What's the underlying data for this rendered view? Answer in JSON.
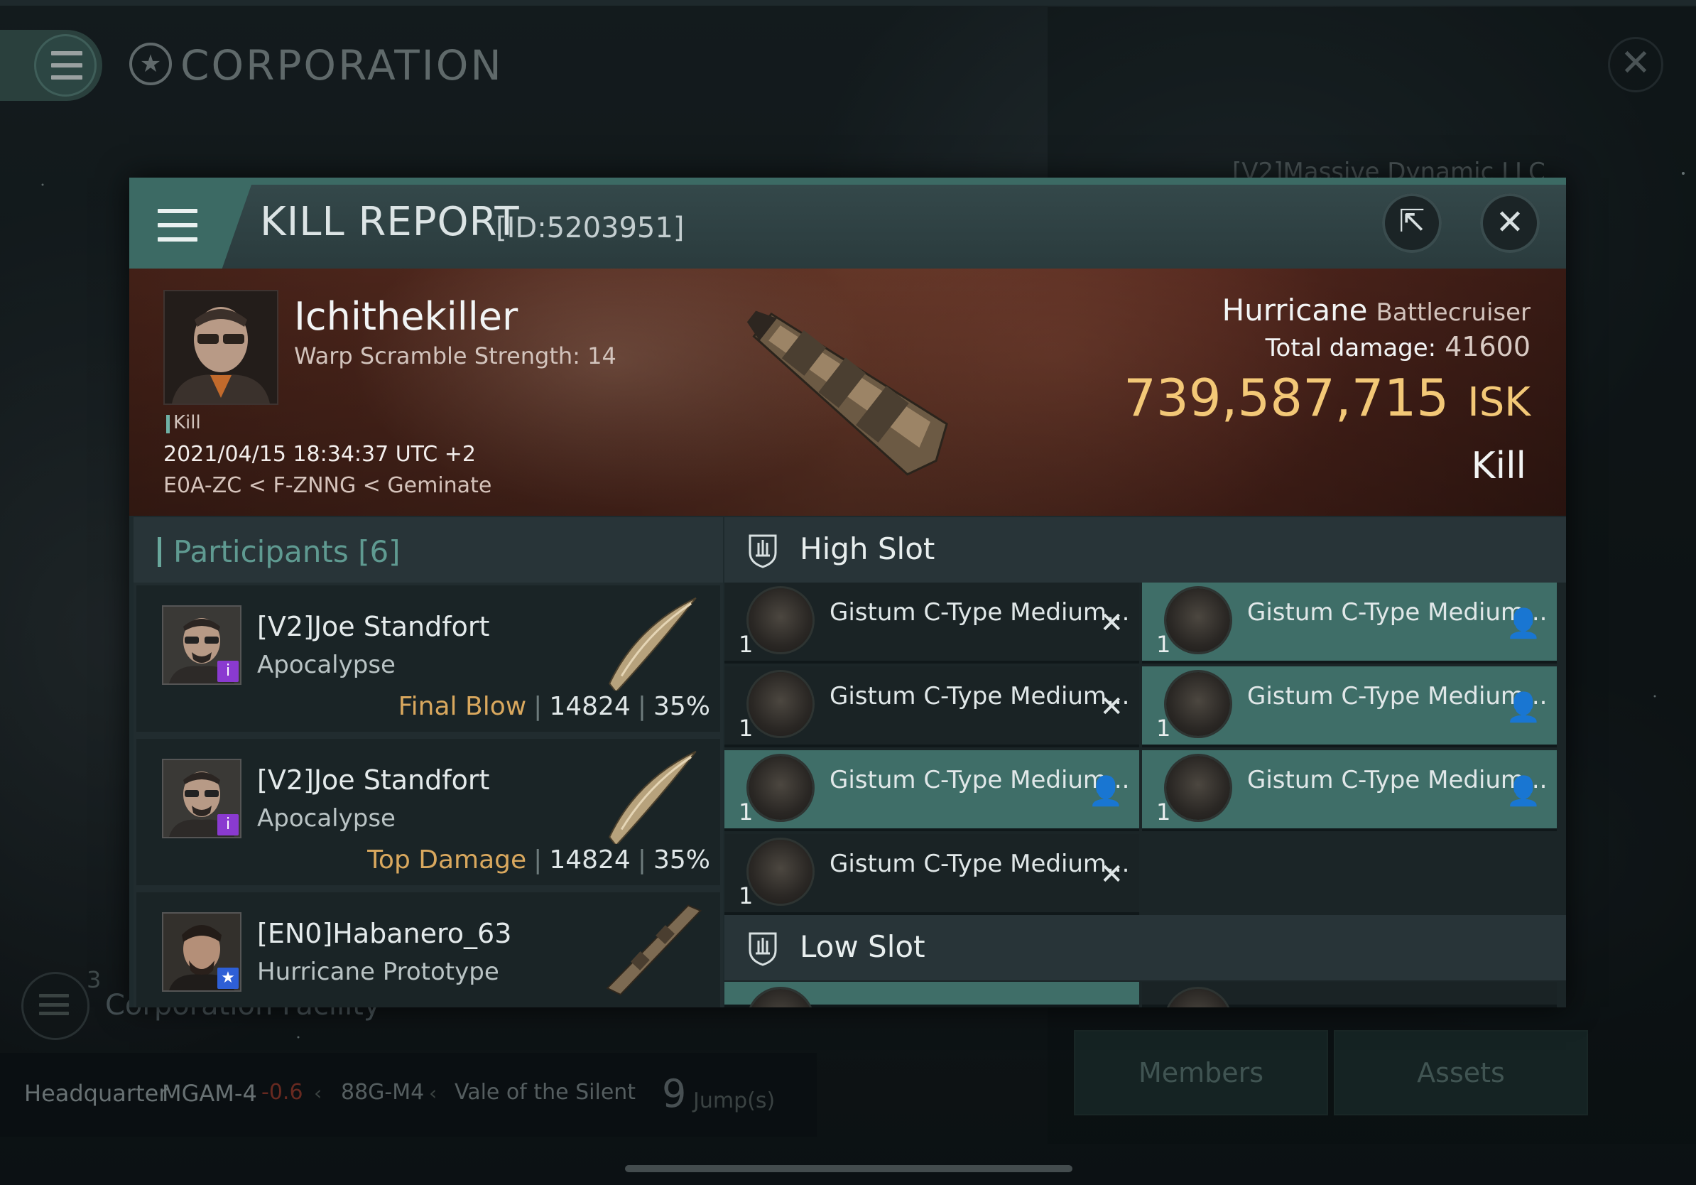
{
  "background": {
    "screen_title": "CORPORATION",
    "corporation_name": "[V2]Massive Dynamic LLC",
    "facility_count": "3",
    "facility_label": "Corporation Facility",
    "headquarter_label": "Headquarter",
    "hq_system": "MGAM-4",
    "hq_security": "-0.6",
    "hq_constellation": "88G-M4",
    "hq_region": "Vale of the Silent",
    "jumps_value": "9",
    "jumps_label": "Jump(s)",
    "members_button": "Members",
    "assets_button": "Assets"
  },
  "modal": {
    "title": "KILL REPORT",
    "id_label": "[ID:5203951]",
    "export_icon": "export-icon",
    "close_icon": "close-icon"
  },
  "victim": {
    "name": "Ichithekiller",
    "warp_scramble": "Warp Scramble Strength: 14",
    "tag": "Kill",
    "time": "2021/04/15 18:34:37 UTC +2",
    "location": "E0A-ZC < F-ZNNG < Geminate",
    "ship_name": "Hurricane",
    "ship_class": "Battlecruiser",
    "total_damage_label": "Total damage:",
    "total_damage_value": "41600",
    "isk_value": "739,587,715",
    "isk_unit": "ISK",
    "result": "Kill"
  },
  "participants": {
    "title": "Participants",
    "count": "[6]",
    "rows": [
      {
        "name": "[V2]Joe Standfort",
        "ship": "Apocalypse",
        "role": "Final Blow",
        "damage": "14824",
        "percent": "35%"
      },
      {
        "name": "[V2]Joe Standfort",
        "ship": "Apocalypse",
        "role": "Top Damage",
        "damage": "14824",
        "percent": "35%"
      },
      {
        "name": "[EN0]Habanero_63",
        "ship": "Hurricane Prototype",
        "role": "",
        "damage": "",
        "percent": ""
      }
    ]
  },
  "slots": {
    "high_title": "High Slot",
    "low_title": "Low Slot",
    "high_modules": [
      {
        "name": "Gistum C-Type Medium...",
        "qty": "1",
        "state": "✕"
      },
      {
        "name": "Gistum C-Type Medium...",
        "qty": "1",
        "state": "👤"
      },
      {
        "name": "Gistum C-Type Medium...",
        "qty": "1",
        "state": "✕"
      },
      {
        "name": "Gistum C-Type Medium...",
        "qty": "1",
        "state": "👤"
      },
      {
        "name": "Gistum C-Type Medium...",
        "qty": "1",
        "state": "👤"
      },
      {
        "name": "Gistum C-Type Medium...",
        "qty": "1",
        "state": "👤"
      },
      {
        "name": "Gistum C-Type Medium...",
        "qty": "1",
        "state": "✕"
      }
    ]
  },
  "colors": {
    "accent_teal": "#3f6e68",
    "isk_gold": "#f3c877",
    "role_orange": "#d9a85e",
    "security_red": "#9a3a2a"
  }
}
